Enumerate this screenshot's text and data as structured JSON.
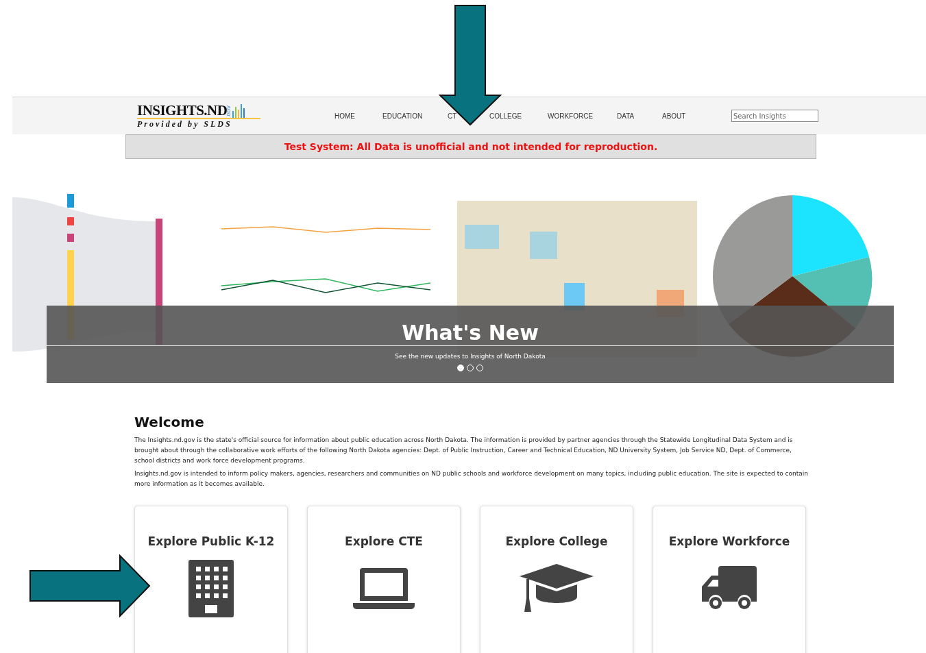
{
  "header": {
    "logo_title": "INSIGHTS.ND",
    "logo_gov": ".GOV",
    "logo_subtitle": "Provided by SLDS",
    "nav": [
      {
        "label": "HOME"
      },
      {
        "label": "EDUCATION"
      },
      {
        "label": "CT"
      },
      {
        "label": "COLLEGE"
      },
      {
        "label": "WORKFORCE"
      },
      {
        "label": "DATA"
      },
      {
        "label": "ABOUT"
      }
    ],
    "search": {
      "placeholder": "Search Insights"
    }
  },
  "notice": "Test System: All Data is unofficial and not intended for reproduction.",
  "carousel": {
    "caption_title": "What's New",
    "caption_text": "See the new updates to Insights of North Dakota",
    "indicators": [
      {
        "selected": true
      },
      {
        "selected": false
      },
      {
        "selected": false
      }
    ]
  },
  "welcome": {
    "title": "Welcome",
    "paragraphs": [
      "The Insights.nd.gov is the state's official source for information about public education across North Dakota. The information is provided by partner agencies through the Statewide Longitudinal Data System and is brought about through the collaborative work efforts of the following North Dakota agencies: Dept. of Public Instruction, Career and Technical Education, ND University System, Job Service ND, Dept. of Commerce, school districts and work force development programs.",
      "Insights.nd.gov is intended to inform policy makers, agencies, researchers and communities on ND public schools and workforce development on many topics, including public education. The site is expected to contain more information as it becomes available."
    ]
  },
  "cards": [
    {
      "title": "Explore Public K-12",
      "kind": "building"
    },
    {
      "title": "Explore CTE",
      "kind": "laptop"
    },
    {
      "title": "Explore College",
      "kind": "cap"
    },
    {
      "title": "Explore Workforce",
      "kind": "truck"
    }
  ]
}
